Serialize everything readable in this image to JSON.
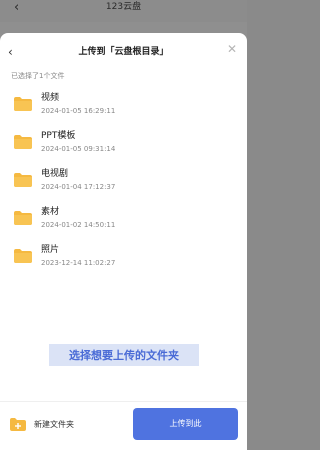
{
  "background": {
    "back_icon": "‹",
    "title": "123云盘"
  },
  "sheet": {
    "back_icon": "‹",
    "title": "上传到「云盘根目录」",
    "close_icon": "✕",
    "selected_count": "已选择了1个文件"
  },
  "folders": [
    {
      "name": "视频",
      "date": "2024-01-05 16:29:11"
    },
    {
      "name": "PPT模板",
      "date": "2024-01-05 09:31:14"
    },
    {
      "name": "电视剧",
      "date": "2024-01-04 17:12:37"
    },
    {
      "name": "素材",
      "date": "2024-01-02 14:50:11"
    },
    {
      "name": "照片",
      "date": "2023-12-14 11:02:27"
    }
  ],
  "hint": "选择想要上传的文件夹",
  "footer": {
    "new_folder_label": "新建文件夹",
    "upload_label": "上传到此"
  },
  "colors": {
    "accent": "#4f73e0",
    "folder": "#f5b941",
    "hint_bg": "#dbe3f6"
  }
}
